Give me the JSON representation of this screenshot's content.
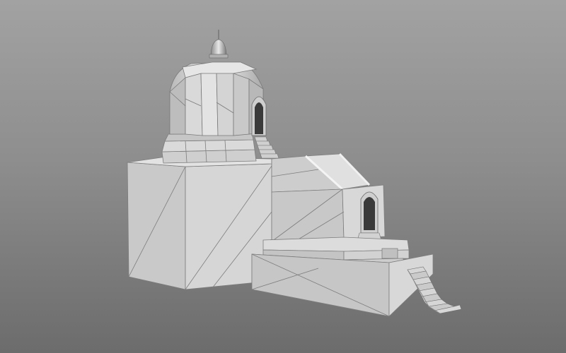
{
  "scene": {
    "background_top": "#a2a2a2",
    "background_bottom": "#6c6c6c",
    "model_fill": "#d2d2d2",
    "model_shadow": "#a8a8a8",
    "wire_color": "#7a7a7a",
    "arch_dark": "#3a3a3a"
  }
}
